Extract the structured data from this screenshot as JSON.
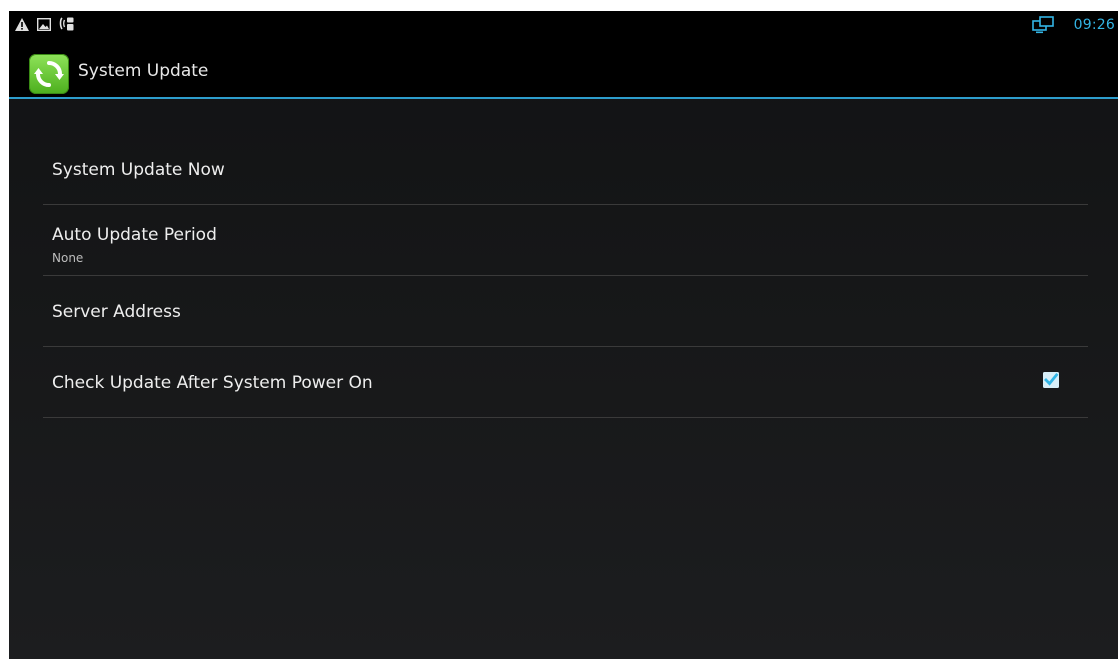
{
  "status_bar": {
    "left_icons": [
      "warning-icon",
      "image-notification-icon",
      "phone-notification-icon"
    ],
    "right_icons": [
      "network-icon"
    ],
    "clock": "09:26"
  },
  "action_bar": {
    "title": "System Update",
    "icon": "system-update-icon"
  },
  "preferences": [
    {
      "title": "System Update Now",
      "summary": ""
    },
    {
      "title": "Auto Update Period",
      "summary": "None"
    },
    {
      "title": "Server Address",
      "summary": ""
    },
    {
      "title": "Check Update After System Power On",
      "summary": "",
      "checked": true
    }
  ],
  "colors": {
    "accent": "#33b5e5",
    "divider": "#3a3a3a",
    "icon_green": "#6cd236"
  }
}
